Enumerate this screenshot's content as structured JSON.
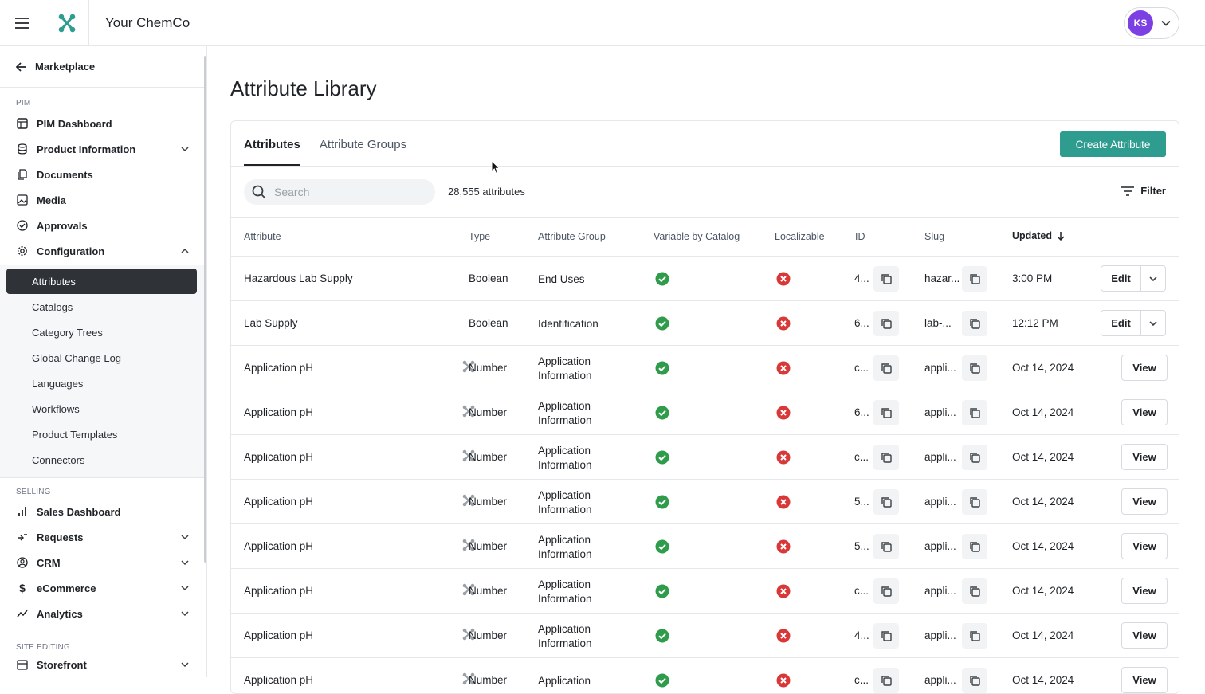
{
  "app": {
    "company": "Your ChemCo",
    "user_initials": "KS",
    "accent": "#2f9c90",
    "avatar_color": "#7b3fe4"
  },
  "sidebar": {
    "back_label": "Marketplace",
    "pim_label": "PIM",
    "pim_items": [
      {
        "label": "PIM Dashboard",
        "icon": "dashboard-icon"
      },
      {
        "label": "Product Information",
        "icon": "database-icon",
        "expandable": true
      },
      {
        "label": "Documents",
        "icon": "documents-icon"
      },
      {
        "label": "Media",
        "icon": "media-icon"
      },
      {
        "label": "Approvals",
        "icon": "approvals-icon"
      },
      {
        "label": "Configuration",
        "icon": "configuration-icon",
        "expanded": true
      }
    ],
    "config_items": [
      "Attributes",
      "Catalogs",
      "Category Trees",
      "Global Change Log",
      "Languages",
      "Workflows",
      "Product Templates",
      "Connectors"
    ],
    "selling_label": "SELLING",
    "selling_items": [
      {
        "label": "Sales Dashboard",
        "icon": "bar-chart-icon"
      },
      {
        "label": "Requests",
        "icon": "requests-icon",
        "expandable": true
      },
      {
        "label": "CRM",
        "icon": "crm-icon",
        "expandable": true
      },
      {
        "label": "eCommerce",
        "icon": "dollar-icon",
        "expandable": true
      },
      {
        "label": "Analytics",
        "icon": "analytics-icon",
        "expandable": true
      }
    ],
    "site_label": "SITE EDITING",
    "site_items": [
      {
        "label": "Storefront",
        "icon": "storefront-icon",
        "expandable": true
      }
    ]
  },
  "page": {
    "title": "Attribute Library",
    "tabs": [
      "Attributes",
      "Attribute Groups"
    ],
    "create_label": "Create Attribute",
    "search_placeholder": "Search",
    "count": "28,555 attributes",
    "filter_label": "Filter"
  },
  "table": {
    "columns": [
      "Attribute",
      "Type",
      "Attribute Group",
      "Variable by Catalog",
      "Localizable",
      "ID",
      "Slug",
      "Updated"
    ],
    "rows": [
      {
        "attribute": "Hazardous Lab Supply",
        "type": "Boolean",
        "group": "End Uses",
        "id": "4...",
        "slug": "hazar...",
        "updated": "3:00 PM",
        "action": "Edit"
      },
      {
        "attribute": "Lab Supply",
        "type": "Boolean",
        "group": "Identification",
        "id": "6...",
        "slug": "lab-...",
        "updated": "12:12 PM",
        "action": "Edit"
      },
      {
        "attribute": "Application pH",
        "type": "Number",
        "group": "Application Information",
        "id": "c...",
        "slug": "appli...",
        "updated": "Oct 14, 2024",
        "action": "View"
      },
      {
        "attribute": "Application pH",
        "type": "Number",
        "group": "Application Information",
        "id": "6...",
        "slug": "appli...",
        "updated": "Oct 14, 2024",
        "action": "View"
      },
      {
        "attribute": "Application pH",
        "type": "Number",
        "group": "Application Information",
        "id": "c...",
        "slug": "appli...",
        "updated": "Oct 14, 2024",
        "action": "View"
      },
      {
        "attribute": "Application pH",
        "type": "Number",
        "group": "Application Information",
        "id": "5...",
        "slug": "appli...",
        "updated": "Oct 14, 2024",
        "action": "View"
      },
      {
        "attribute": "Application pH",
        "type": "Number",
        "group": "Application Information",
        "id": "5...",
        "slug": "appli...",
        "updated": "Oct 14, 2024",
        "action": "View"
      },
      {
        "attribute": "Application pH",
        "type": "Number",
        "group": "Application Information",
        "id": "c...",
        "slug": "appli...",
        "updated": "Oct 14, 2024",
        "action": "View"
      },
      {
        "attribute": "Application pH",
        "type": "Number",
        "group": "Application Information",
        "id": "4...",
        "slug": "appli...",
        "updated": "Oct 14, 2024",
        "action": "View"
      },
      {
        "attribute": "Application pH",
        "type": "Number",
        "group": "Application",
        "id": "c...",
        "slug": "appli...",
        "updated": "Oct 14, 2024",
        "action": "View"
      }
    ]
  }
}
